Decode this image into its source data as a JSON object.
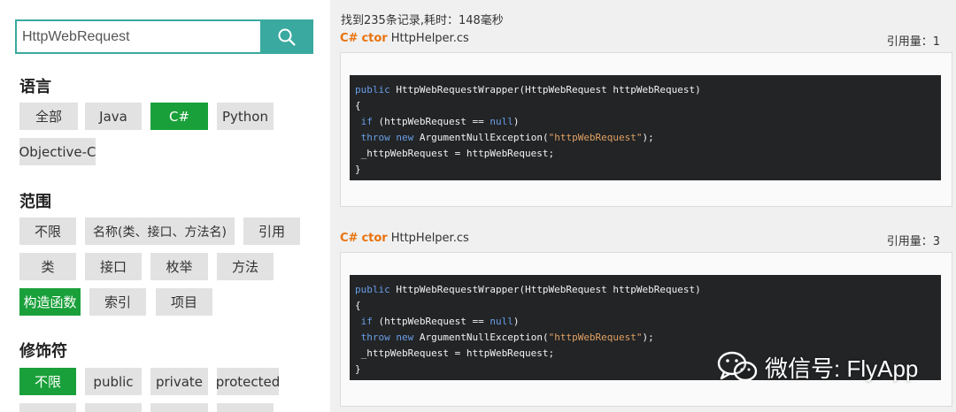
{
  "search": {
    "value": "HttpWebRequest",
    "placeholder": ""
  },
  "sections": {
    "language": {
      "title": "语言",
      "items": [
        "全部",
        "Java",
        "C#",
        "Python",
        "Objective-C"
      ]
    },
    "scope": {
      "title": "范围",
      "items": [
        "不限",
        "名称(类、接口、方法名)",
        "引用",
        "类",
        "接口",
        "枚举",
        "方法",
        "构造函数",
        "索引",
        "项目"
      ]
    },
    "modifier": {
      "title": "修饰符",
      "items": [
        "不限",
        "public",
        "private",
        "protected"
      ]
    }
  },
  "colors": {
    "accent": "#3aa99f",
    "active": "#1aa03a",
    "orange": "#e8720c"
  },
  "summary": "找到235条记录,耗时：148毫秒",
  "results": [
    {
      "lang": "C#",
      "kind": "ctor",
      "file": "HttpHelper.cs",
      "refs": "引用量：1",
      "code": {
        "l1a": "public",
        "l1b": " HttpWebRequestWrapper(HttpWebRequest httpWebRequest)",
        "l2": "{",
        "l3a": " if",
        "l3b": " (httpWebRequest == ",
        "l3c": "null",
        "l3d": ")",
        "l4a": " throw",
        "l4b": " ",
        "l4c": "new",
        "l4d": " ArgumentNullException(",
        "l4e": "\"httpWebRequest\"",
        "l4f": ");",
        "l5": " _httpWebRequest = httpWebRequest;",
        "l6": "}"
      }
    },
    {
      "lang": "C#",
      "kind": "ctor",
      "file": "HttpHelper.cs",
      "refs": "引用量：3",
      "code": {
        "l1a": "public",
        "l1b": " HttpWebRequestWrapper(HttpWebRequest httpWebRequest)",
        "l2": "{",
        "l3a": " if",
        "l3b": " (httpWebRequest == ",
        "l3c": "null",
        "l3d": ")",
        "l4a": " throw",
        "l4b": " ",
        "l4c": "new",
        "l4d": " ArgumentNullException(",
        "l4e": "\"httpWebRequest\"",
        "l4f": ");",
        "l5": " _httpWebRequest = httpWebRequest;",
        "l6": "}"
      }
    }
  ],
  "watermark": "微信号: FlyApp"
}
